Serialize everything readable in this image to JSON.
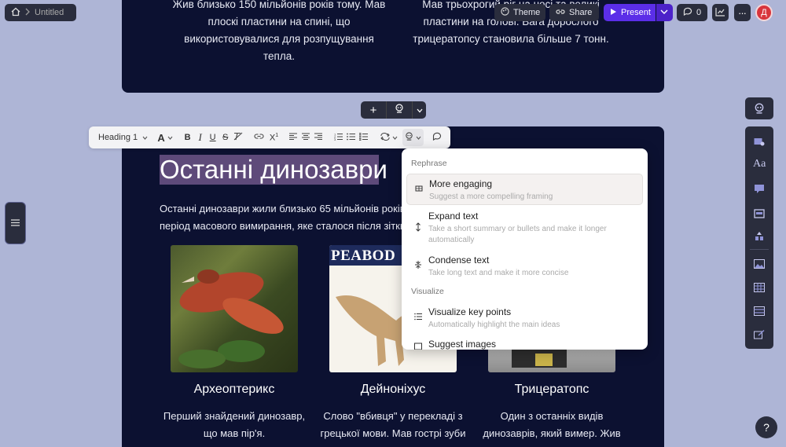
{
  "topbar": {
    "breadcrumb_title": "Untitled",
    "theme_label": "Theme",
    "share_label": "Share",
    "present_label": "Present",
    "comments_count": "0",
    "avatar_letter": "Д"
  },
  "card1": {
    "col1_lines": [
      "Жив близько 150 мільйонів років тому. Мав",
      "плоскі пластини на спині, що",
      "використовувалися для розпущування",
      "тепла."
    ],
    "col2_lines": [
      "Мав трьохрогий ріг на носі та великі",
      "пластини на голові. Вага дорослого",
      "трицератопсу становила більше 7 тонн."
    ]
  },
  "insert_bar": {
    "add_label": "+"
  },
  "toolbar": {
    "style_select": "Heading 1"
  },
  "card2": {
    "heading": "Останні динозаври",
    "para_line1": "Останні динозаври жили близько 65 мільйонів років",
    "para_line2": "період масового вимирання, яке сталося після зіткне",
    "items": [
      {
        "name": "Археоптерикс",
        "desc1": "Перший знайдений динозавр,",
        "desc2": "що мав пір'я."
      },
      {
        "name": "Дейноніхус",
        "desc1": "Слово \"вбивця\" у перекладі з",
        "desc2": "грецької мови. Мав гострі зуби"
      },
      {
        "name": "Трицератопс",
        "desc1": "Один з останніх видів",
        "desc2": "динозаврів, який вимер. Жив"
      }
    ],
    "peabody_text": "PEABOD"
  },
  "menu": {
    "section1": "Rephrase",
    "section2": "Visualize",
    "items": [
      {
        "title": "More engaging",
        "desc": "Suggest a more compelling framing"
      },
      {
        "title": "Expand text",
        "desc": "Take a short summary or bullets and make it longer automatically"
      },
      {
        "title": "Condense text",
        "desc": "Take long text and make it more concise"
      },
      {
        "title": "Visualize key points",
        "desc": "Automatically highlight the main ideas"
      },
      {
        "title": "Suggest images",
        "desc": ""
      }
    ]
  },
  "help": {
    "label": "?"
  },
  "colors": {
    "accent": "#5b2ee8",
    "card_bg": "#0c1131",
    "page_bg": "#aeb5d6"
  }
}
